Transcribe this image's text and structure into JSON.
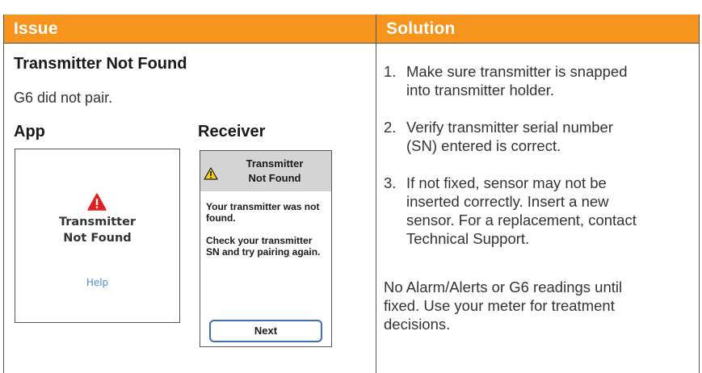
{
  "header": {
    "issue_label": "Issue",
    "solution_label": "Solution",
    "color": "#f7941d"
  },
  "issue": {
    "title": "Transmitter Not Found",
    "description": "G6 did not pair.",
    "app_label": "App",
    "receiver_label": "Receiver"
  },
  "app_screen": {
    "icon": "warning-triangle-icon",
    "message_line1": "Transmitter",
    "message_line2": "Not Found",
    "help_link": "Help",
    "warn_color": "#e02020",
    "link_color": "#4a8bd4"
  },
  "receiver_screen": {
    "icon": "warning-triangle-icon",
    "title_line1": "Transmitter",
    "title_line2": "Not Found",
    "body_line1": "Your transmitter was not",
    "body_line2": "found.",
    "body_line3": "Check your transmitter",
    "body_line4": "SN and try pairing again.",
    "next_button": "Next",
    "button_color": "#3d70b2"
  },
  "solution": {
    "steps": [
      {
        "num": "1.",
        "line1": "Make sure transmitter is snapped",
        "line2": "into transmitter holder."
      },
      {
        "num": "2.",
        "line1": "Verify transmitter serial number",
        "line2": "(SN) entered is correct."
      },
      {
        "num": "3.",
        "line1": "If not fixed, sensor may not be",
        "line2": "inserted correctly. Insert a new",
        "line3": "sensor. For a replacement, contact",
        "line4": "Technical Support."
      }
    ],
    "note_line1": "No Alarm/Alerts or G6 readings until",
    "note_line2": "fixed. Use your meter for treatment",
    "note_line3": "decisions."
  }
}
